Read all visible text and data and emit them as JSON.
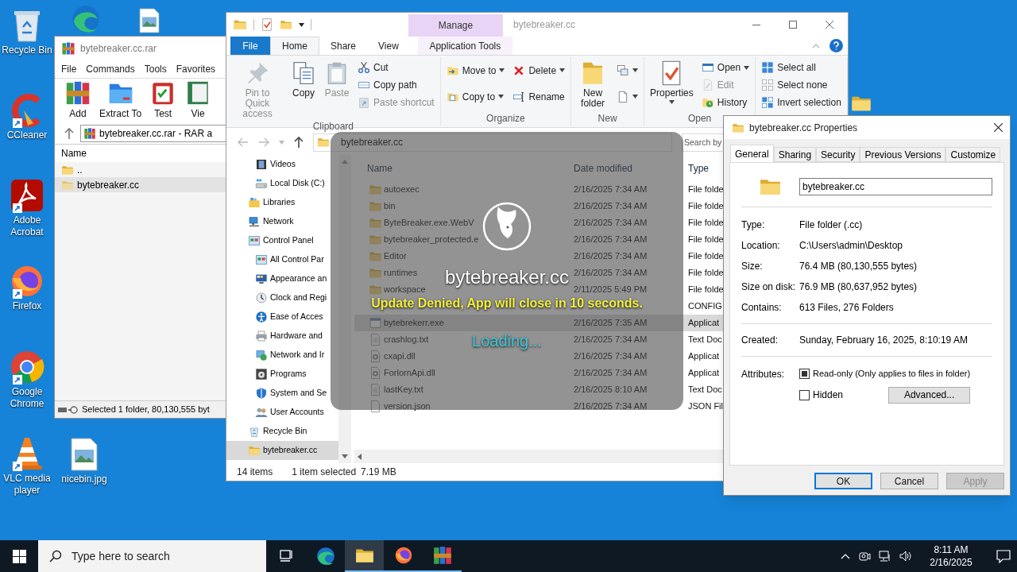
{
  "desktop": {
    "icons": [
      {
        "kind": "recycle",
        "label": "Recycle Bin",
        "shortcut": false
      },
      {
        "kind": "ccleaner",
        "label": "CCleaner",
        "shortcut": true
      },
      {
        "kind": "acrobat",
        "label": "Adobe Acrobat",
        "shortcut": true
      },
      {
        "kind": "firefox",
        "label": "Firefox",
        "shortcut": true
      },
      {
        "kind": "chrome",
        "label": "Google Chrome",
        "shortcut": true
      },
      {
        "kind": "vlc",
        "label": "VLC media player",
        "shortcut": true
      },
      {
        "kind": "edge",
        "shortcut": false
      },
      {
        "kind": "image",
        "shortcut": false
      },
      {
        "kind": "image",
        "label": "nicebin.jpg",
        "shortcut": false
      },
      {
        "kind": "folder",
        "shortcut": false
      }
    ]
  },
  "winrar": {
    "title": "bytebreaker.cc.rar",
    "menu": [
      "File",
      "Commands",
      "Tools",
      "Favorites"
    ],
    "toolbar": [
      {
        "kind": "add",
        "label": "Add"
      },
      {
        "kind": "extract",
        "label": "Extract To"
      },
      {
        "kind": "test",
        "label": "Test"
      },
      {
        "kind": "view",
        "label": "Vie"
      }
    ],
    "address": "bytebreaker.cc.rar - RAR a",
    "columns": [
      "Name"
    ],
    "rows": [
      {
        "name": "..",
        "selected": false
      },
      {
        "name": "bytebreaker.cc",
        "selected": true
      }
    ],
    "status": "Selected 1 folder, 80,130,555 byt"
  },
  "explorer": {
    "title": "bytebreaker.cc",
    "context_group": "Manage",
    "ribbon_tabs": [
      {
        "label": "File",
        "kind": "file",
        "selected": false
      },
      {
        "label": "Home",
        "kind": "tab",
        "selected": true
      },
      {
        "label": "Share",
        "kind": "tab",
        "selected": false
      },
      {
        "label": "View",
        "kind": "tab",
        "selected": false
      },
      {
        "label": "Application Tools",
        "kind": "contextual",
        "selected": false
      }
    ],
    "ribbon_groups": [
      {
        "label": "Clipboard",
        "items": [
          {
            "kind": "large",
            "label": "Pin to Quick access",
            "disabled": true,
            "dropdown": false
          },
          {
            "kind": "large",
            "label": "Copy",
            "disabled": false,
            "dropdown": false
          },
          {
            "kind": "large",
            "label": "Paste",
            "disabled": true,
            "dropdown": false
          },
          {
            "kind": "stack",
            "items": [
              {
                "label": "Cut",
                "disabled": false,
                "dropdown": false
              },
              {
                "label": "Copy path",
                "disabled": false,
                "dropdown": false
              },
              {
                "label": "Paste shortcut",
                "disabled": true,
                "dropdown": false
              }
            ]
          }
        ]
      },
      {
        "label": "Organize",
        "items": [
          {
            "kind": "stack",
            "items": [
              {
                "label": "Move to",
                "disabled": false,
                "dropdown": true
              },
              {
                "label": "Copy to",
                "disabled": false,
                "dropdown": true
              }
            ]
          },
          {
            "kind": "stack",
            "items": [
              {
                "label": "Delete",
                "disabled": false,
                "dropdown": true
              },
              {
                "label": "Rename",
                "disabled": false,
                "dropdown": false
              }
            ]
          }
        ]
      },
      {
        "label": "New",
        "items": [
          {
            "kind": "large",
            "label": "New folder",
            "disabled": false,
            "dropdown": false
          },
          {
            "kind": "stack",
            "items": [
              {
                "disabled": false,
                "dropdown": true
              },
              {
                "disabled": false,
                "dropdown": true
              }
            ]
          }
        ]
      },
      {
        "label": "Open",
        "items": [
          {
            "kind": "large",
            "label": "Properties",
            "disabled": false,
            "dropdown": true
          },
          {
            "kind": "stack",
            "items": [
              {
                "label": "Open",
                "disabled": false,
                "dropdown": true
              },
              {
                "label": "Edit",
                "disabled": true,
                "dropdown": false
              },
              {
                "label": "History",
                "disabled": false,
                "dropdown": false
              }
            ]
          }
        ]
      },
      {
        "items": [
          {
            "kind": "stack",
            "items": [
              {
                "label": "Select all",
                "disabled": false,
                "dropdown": false
              },
              {
                "label": "Select none",
                "disabled": false,
                "dropdown": false
              },
              {
                "label": "Invert selection",
                "disabled": false,
                "dropdown": false
              }
            ]
          }
        ]
      }
    ],
    "address": "bytebreaker.cc",
    "search_placeholder": "Search by",
    "nav_pane": {
      "continued": [
        {
          "kind": "videos",
          "label": "Videos",
          "selected": false
        },
        {
          "kind": "disk",
          "label": "Local Disk (C:)",
          "selected": false
        }
      ],
      "items": [
        {
          "kind": "libraries",
          "label": "Libraries",
          "selected": false
        },
        {
          "kind": "network",
          "label": "Network",
          "selected": false
        },
        {
          "kind": "control",
          "label": "Control Panel",
          "selected": false,
          "children": [
            {
              "kind": "control",
              "label": "All Control Par",
              "selected": false
            },
            {
              "kind": "appearance",
              "label": "Appearance an",
              "selected": false
            },
            {
              "kind": "clock",
              "label": "Clock and Regi",
              "selected": false
            },
            {
              "kind": "ease",
              "label": "Ease of Acces",
              "selected": false
            },
            {
              "kind": "hardware",
              "label": "Hardware and",
              "selected": false
            },
            {
              "kind": "netint",
              "label": "Network and Ir",
              "selected": false
            },
            {
              "kind": "programs",
              "label": "Programs",
              "selected": false
            },
            {
              "kind": "system",
              "label": "System and Se",
              "selected": false
            },
            {
              "kind": "users",
              "label": "User Accounts",
              "selected": false
            }
          ]
        },
        {
          "kind": "recycle",
          "label": "Recycle Bin",
          "selected": false
        },
        {
          "kind": "folder",
          "label": "bytebreaker.cc",
          "selected": true
        }
      ]
    },
    "columns": [
      "Name",
      "Date modified",
      "Type"
    ],
    "files": [
      {
        "kind": "folder",
        "name": "autoexec",
        "date": "2/16/2025 7:34 AM",
        "type": "File folde",
        "selected": false
      },
      {
        "kind": "folder",
        "name": "bin",
        "date": "2/16/2025 7:34 AM",
        "type": "File folde",
        "selected": false
      },
      {
        "kind": "folder",
        "name": "ByteBreaker.exe.WebV",
        "date": "2/16/2025 7:34 AM",
        "type": "File folde",
        "selected": false
      },
      {
        "kind": "folder",
        "name": "bytebreaker_protected.e",
        "date": "2/16/2025 7:34 AM",
        "type": "File folde",
        "selected": false
      },
      {
        "kind": "folder",
        "name": "Editor",
        "date": "2/16/2025 7:34 AM",
        "type": "File folde",
        "selected": false
      },
      {
        "kind": "folder",
        "name": "runtimes",
        "date": "2/16/2025 7:34 AM",
        "type": "File folde",
        "selected": false
      },
      {
        "kind": "folder",
        "name": "workspace",
        "date": "2/11/2025 5:49 PM",
        "type": "File folde",
        "selected": false
      },
      {
        "type": "CONFIG",
        "selected": false
      },
      {
        "kind": "exe",
        "name": "bytebrekerr.exe",
        "date": "2/16/2025 7:35 AM",
        "type": "Applicat",
        "selected": true
      },
      {
        "kind": "doc",
        "name": "crashlog.txt",
        "date": "2/16/2025 7:34 AM",
        "type": "Text Doc",
        "selected": false
      },
      {
        "kind": "dll",
        "name": "cxapi.dll",
        "date": "2/16/2025 7:34 AM",
        "type": "Applicat",
        "selected": false
      },
      {
        "kind": "dll",
        "name": "ForlornApi.dll",
        "date": "2/16/2025 7:34 AM",
        "type": "Applicat",
        "selected": false
      },
      {
        "kind": "doc",
        "name": "lastKey.txt",
        "date": "2/16/2025 8:10 AM",
        "type": "Text Doc",
        "selected": false
      },
      {
        "kind": "blank",
        "name": "version.json",
        "date": "2/16/2025 7:34 AM",
        "type": "JSON Fil",
        "selected": false
      }
    ],
    "status": {
      "count": "14 items",
      "selection": "1 item selected",
      "size": "7.19 MB"
    },
    "overlay": {
      "title": "bytebreaker.cc",
      "message": "Update Denied, App will close in 10 seconds.",
      "loading": "Loading..."
    }
  },
  "properties": {
    "title": "bytebreaker.cc Properties",
    "tabs": [
      {
        "label": "General",
        "selected": true
      },
      {
        "label": "Sharing",
        "selected": false
      },
      {
        "label": "Security",
        "selected": false
      },
      {
        "label": "Previous Versions",
        "selected": false
      },
      {
        "label": "Customize",
        "selected": false
      }
    ],
    "name": "bytebreaker.cc",
    "details": [
      {
        "label": "Type:",
        "value": "File folder (.cc)"
      },
      {
        "label": "Location:",
        "value": "C:\\Users\\admin\\Desktop"
      },
      {
        "label": "Size:",
        "value": "76.4 MB (80,130,555 bytes)"
      },
      {
        "label": "Size on disk:",
        "value": "76.9 MB (80,637,952 bytes)"
      },
      {
        "label": "Contains:",
        "value": "613 Files, 276 Folders"
      }
    ],
    "created": {
      "label": "Created:",
      "value": "Sunday, February 16, 2025, 8:10:19 AM"
    },
    "attributes_label": "Attributes:",
    "attributes": [
      {
        "label": "Read-only (Only applies to files in folder)",
        "checked": true
      },
      {
        "label": "Hidden",
        "checked": false
      }
    ],
    "advanced_button": "Advanced...",
    "buttons": [
      {
        "label": "OK",
        "default": true,
        "disabled": false
      },
      {
        "label": "Cancel",
        "default": false,
        "disabled": false
      },
      {
        "label": "Apply",
        "default": false,
        "disabled": true
      }
    ]
  },
  "taskbar": {
    "search_placeholder": "Type here to search",
    "apps": [
      {
        "kind": "taskview",
        "active": false,
        "running": false
      },
      {
        "kind": "edge",
        "active": false,
        "running": false
      },
      {
        "kind": "explorer",
        "active": true,
        "running": true
      },
      {
        "kind": "firefox",
        "active": false,
        "running": true
      },
      {
        "kind": "winrar",
        "active": false,
        "running": true
      }
    ],
    "time": "8:11 AM",
    "date": "2/16/2025"
  }
}
